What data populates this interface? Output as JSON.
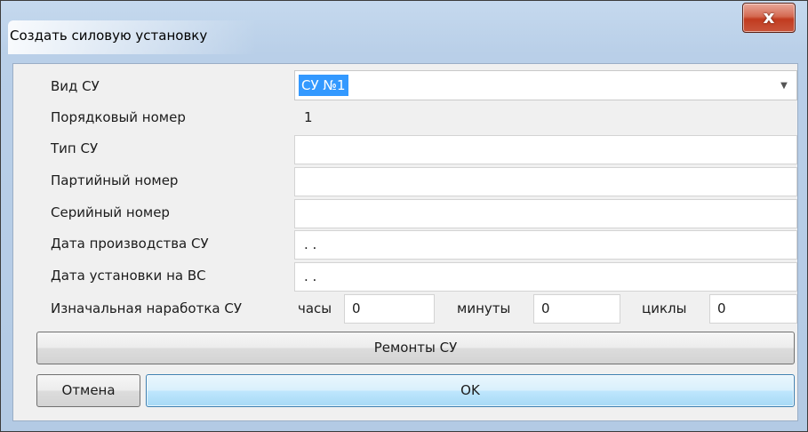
{
  "window": {
    "title": "Создать силовую установку",
    "close_glyph": "x"
  },
  "form": {
    "vid_su": {
      "label": "Вид СУ",
      "value": "СУ №1"
    },
    "poryadkovy_nomer": {
      "label": "Порядковый номер",
      "value": "1"
    },
    "tip_su": {
      "label": "Тип СУ",
      "value": ""
    },
    "partiyny_nomer": {
      "label": "Партийный номер",
      "value": ""
    },
    "seriyny_nomer": {
      "label": "Серийный номер",
      "value": ""
    },
    "data_proizvodstva": {
      "label": "Дата производства СУ",
      "value": " . ."
    },
    "data_ustanovki": {
      "label": "Дата установки на ВС",
      "value": " . ."
    },
    "narabotka": {
      "label": "Изначальная наработка СУ",
      "hours_label": "часы",
      "hours_value": "0",
      "minutes_label": "минуты",
      "minutes_value": "0",
      "cycles_label": "циклы",
      "cycles_value": "0"
    }
  },
  "buttons": {
    "repairs": "Ремонты СУ",
    "cancel": "Отмена",
    "ok": "OK"
  },
  "icons": {
    "dropdown": "chevron-down-icon",
    "close": "close-icon"
  }
}
